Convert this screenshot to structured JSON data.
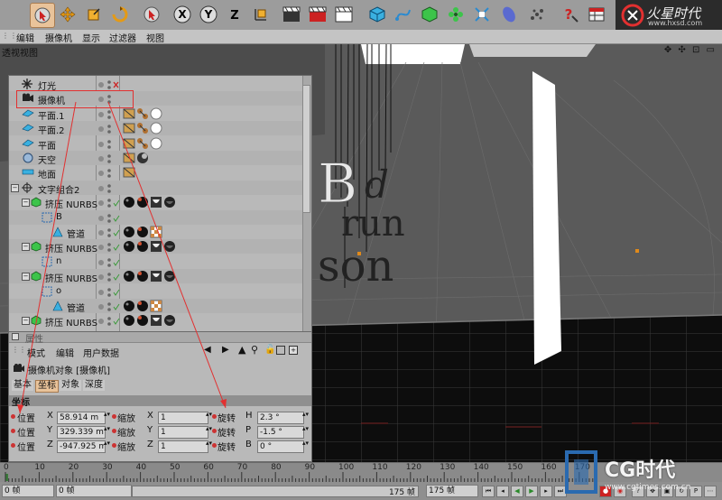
{
  "menubar": {
    "items": [
      "编辑",
      "摄像机",
      "显示",
      "过滤器",
      "视图"
    ]
  },
  "viewport": {
    "title": "透视视图",
    "nav_icons": "✥ ✣ ⊡ ▭"
  },
  "scene_text": {
    "letters": [
      "B",
      "d",
      "run",
      "son"
    ]
  },
  "object_manager": {
    "rows": [
      {
        "name": "灯光",
        "level": 0,
        "icon": "light-icon"
      },
      {
        "name": "摄像机",
        "level": 0,
        "icon": "camera-icon"
      },
      {
        "name": "平面.1",
        "level": 0,
        "icon": "plane-icon"
      },
      {
        "name": "平面.2",
        "level": 0,
        "icon": "plane-icon"
      },
      {
        "name": "平面",
        "level": 0,
        "icon": "plane-icon"
      },
      {
        "name": "天空",
        "level": 0,
        "icon": "sky-icon"
      },
      {
        "name": "地面",
        "level": 0,
        "icon": "floor-icon"
      },
      {
        "name": "文字组合2",
        "level": 0,
        "icon": "null-icon"
      },
      {
        "name": "挤压 NURBS",
        "level": 1,
        "icon": "extrude-icon"
      },
      {
        "name": "B",
        "level": 2,
        "icon": "spline-icon"
      },
      {
        "name": "管道",
        "level": 3,
        "icon": "tube-icon"
      },
      {
        "name": "挤压 NURBS",
        "level": 1,
        "icon": "extrude-icon"
      },
      {
        "name": "n",
        "level": 2,
        "icon": "spline-icon"
      },
      {
        "name": "挤压 NURBS",
        "level": 1,
        "icon": "extrude-icon"
      },
      {
        "name": "o",
        "level": 2,
        "icon": "spline-icon"
      },
      {
        "name": "管道",
        "level": 3,
        "icon": "tube-icon"
      },
      {
        "name": "挤压 NURBS",
        "level": 1,
        "icon": "extrude-icon"
      }
    ]
  },
  "attributes": {
    "header_label": "属性",
    "menu": [
      "模式",
      "编辑",
      "用户数据"
    ],
    "object_title": "摄像机对象 [摄像机]",
    "tabs": [
      "基本",
      "坐标",
      "对象",
      "深度"
    ],
    "section": "坐标",
    "position": {
      "label": "位置",
      "x": "58.914 m",
      "y": "329.339 m",
      "z": "-947.925 m"
    },
    "scale": {
      "label": "缩放",
      "x": "1",
      "y": "1",
      "z": "1"
    },
    "rotation": {
      "label": "旋转",
      "h": "2.3 °",
      "p": "-1.5 °",
      "b": "0 °"
    },
    "axis": {
      "x": "X",
      "y": "Y",
      "z": "Z",
      "h": "H",
      "p": "P",
      "b": "B"
    }
  },
  "timeline": {
    "ticks": [
      "0",
      "10",
      "20",
      "30",
      "40",
      "50",
      "60",
      "70",
      "80",
      "90",
      "100",
      "110",
      "120",
      "130",
      "140",
      "150",
      "160",
      "170"
    ],
    "current_frame": "0 帧",
    "start_frame": "0 帧",
    "end_frame_a": "175 帧",
    "end_frame_b": "175 帧"
  },
  "logo": {
    "brand": "火星时代",
    "url": "www.hxsd.com"
  },
  "watermark": {
    "brand": "CG时代",
    "url": "www.cgtimes.com.cn"
  },
  "colors": {
    "accent_red": "#e23030",
    "tab_active": "#e9c39a"
  }
}
